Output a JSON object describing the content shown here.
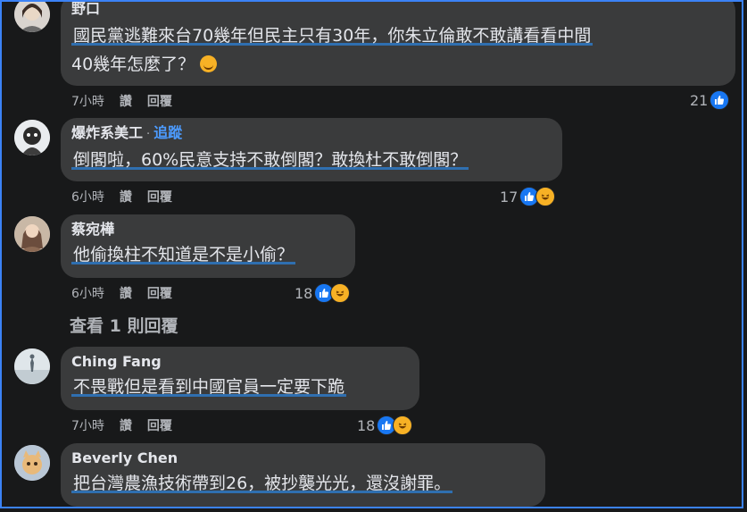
{
  "comments": [
    {
      "author": "野口",
      "lines": [
        "國民黨逃難來台70幾年但民主只有30年，你朱立倫敢不敢講看看中間",
        "40幾年怎麼了？"
      ],
      "emoji": "smiling-face",
      "time": "7小時",
      "like_label": "讚",
      "reply_label": "回覆",
      "reactions": {
        "count": "21",
        "types": [
          "like"
        ]
      }
    },
    {
      "author": "爆炸系美工",
      "follow": "追蹤",
      "lines": [
        "倒閣啦，60%民意支持不敢倒閣？敢換杜不敢倒閣？"
      ],
      "time": "6小時",
      "like_label": "讚",
      "reply_label": "回覆",
      "reactions": {
        "count": "17",
        "types": [
          "like",
          "haha"
        ]
      }
    },
    {
      "author": "蔡宛樺",
      "lines": [
        "他偷換柱不知道是不是小偷？"
      ],
      "time": "6小時",
      "like_label": "讚",
      "reply_label": "回覆",
      "reactions": {
        "count": "18",
        "types": [
          "like",
          "haha"
        ]
      }
    },
    {
      "author": "Ching Fang",
      "lines": [
        "不畏戰但是看到中國官員一定要下跪"
      ],
      "time": "7小時",
      "like_label": "讚",
      "reply_label": "回覆",
      "reactions": {
        "count": "18",
        "types": [
          "like",
          "haha"
        ]
      }
    },
    {
      "author": "Beverly Chen",
      "lines": [
        "把台灣農漁技術帶到26，被抄襲光光，還沒謝罪。"
      ]
    }
  ],
  "view_replies": "查看 1 則回覆",
  "colors": {
    "accent": "#1877f2",
    "highlight": "#2f6fb0",
    "frame": "#3b82f6",
    "bubble": "#3a3b3c"
  }
}
